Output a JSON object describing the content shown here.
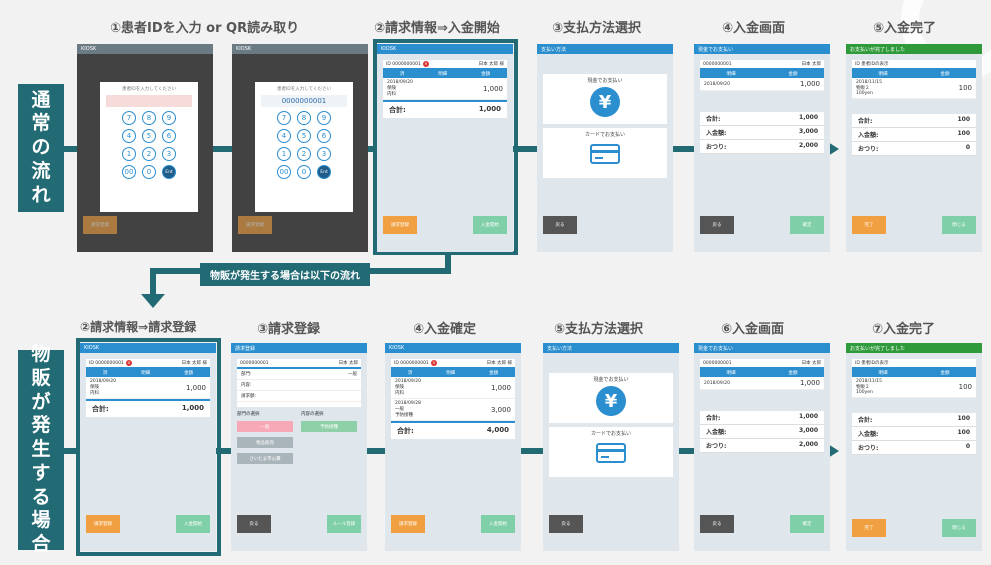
{
  "row_labels": {
    "normal": [
      "通",
      "常",
      "の",
      "流",
      "れ"
    ],
    "goods": [
      "物",
      "販",
      "が",
      "発",
      "生",
      "す",
      "る",
      "場",
      "合"
    ]
  },
  "branch_label": "物販が発生する場合は以下の流れ",
  "row1_steps": [
    "①患者IDを入力 or QR読み取り",
    "②請求情報⇒入金開始",
    "③支払方法選択",
    "④入金画面",
    "⑤入金完了"
  ],
  "row2_steps": [
    "②請求情報⇒請求登録",
    "③請求登録",
    "④入金確定",
    "⑤支払方法選択",
    "⑥入金画面",
    "⑦入金完了"
  ],
  "screen": {
    "kiosk": "KIOSK",
    "id_label": "ID",
    "patient_id": "0000000001",
    "patient_name": "日本 太郎",
    "honorific": "様",
    "col_no": "済",
    "col_detail": "明細",
    "col_amount": "金額",
    "date1": "2018/09/20",
    "kind_hoken": "保険",
    "kind_naika": "内科",
    "amount1": "1,000",
    "date2": "2018/09/28",
    "kind_ippan": "一般",
    "kind_yobo": "予防接種",
    "amount2": "3,000",
    "total_label": "合計:",
    "total1": "1,000",
    "total2": "4,000",
    "keypad_prompt": "患者IDを入力してください",
    "keys": [
      "7",
      "8",
      "9",
      "4",
      "5",
      "6",
      "1",
      "2",
      "3",
      "00",
      "0",
      "Ent"
    ],
    "pay_method_title": "支払い方法",
    "cash": "現金でお支払い",
    "card": "カードでお支払い",
    "yen": "¥",
    "pay_screen_title": "現金でお支払い",
    "paid_label": "入金額:",
    "change_label": "おつり:",
    "paid": "3,000",
    "change": "2,000",
    "complete_title": "お支払いが完了しました",
    "complete_id": "ID 患者IDの表示",
    "complete_date": "2018/11/15",
    "complete_kind": "物販２",
    "complete_unit": "100yen",
    "complete_amount": "100",
    "complete_paid": "100",
    "complete_change": "0",
    "billing_title": "請求登録",
    "dept_label": "部門:",
    "dept_value": "一般",
    "content_label": "内容:",
    "billing_amount_label": "請求額:",
    "dept_select_label": "部門の選択",
    "content_select_label": "内容の選択",
    "dept_options": [
      "一般",
      "物品販売",
      "さいたま市公費"
    ],
    "content_option": "予防接種",
    "btn_back": "戻る",
    "btn_cancel": "請求登録",
    "btn_next": "入金開始",
    "btn_register": "ルール登録",
    "btn_confirm": "確定",
    "btn_done": "完了",
    "btn_close": "閉じる"
  }
}
